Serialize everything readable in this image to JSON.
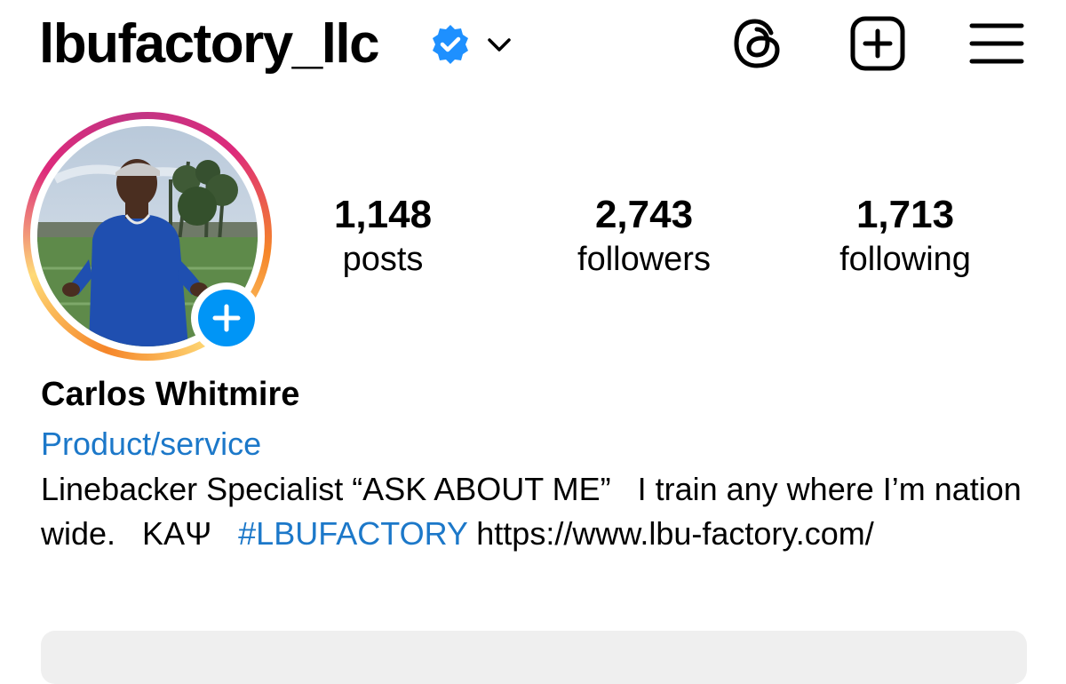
{
  "header": {
    "username": "lbufactory_llc",
    "icons": {
      "verified": "verified-badge-icon",
      "chevron": "chevron-down-icon",
      "threads": "threads-icon",
      "create": "create-post-icon",
      "menu": "hamburger-menu-icon"
    }
  },
  "profile": {
    "stats": [
      {
        "value": "1,148",
        "label": "posts"
      },
      {
        "value": "2,743",
        "label": "followers"
      },
      {
        "value": "1,713",
        "label": "following"
      }
    ],
    "name": "Carlos Whitmire",
    "category": "Product/service",
    "bio": {
      "line1": "Linebacker Specialist “ASK ABOUT ME”   I train any where I’m nation wide.   ΚΑΨ   ",
      "hashtag": "#LBUFACTORY",
      "link": " https://www.lbu-factory.com/"
    }
  },
  "colors": {
    "accent_blue": "#0095f6",
    "link_blue": "#1c78c9",
    "verified_blue": "#1e90ff"
  }
}
